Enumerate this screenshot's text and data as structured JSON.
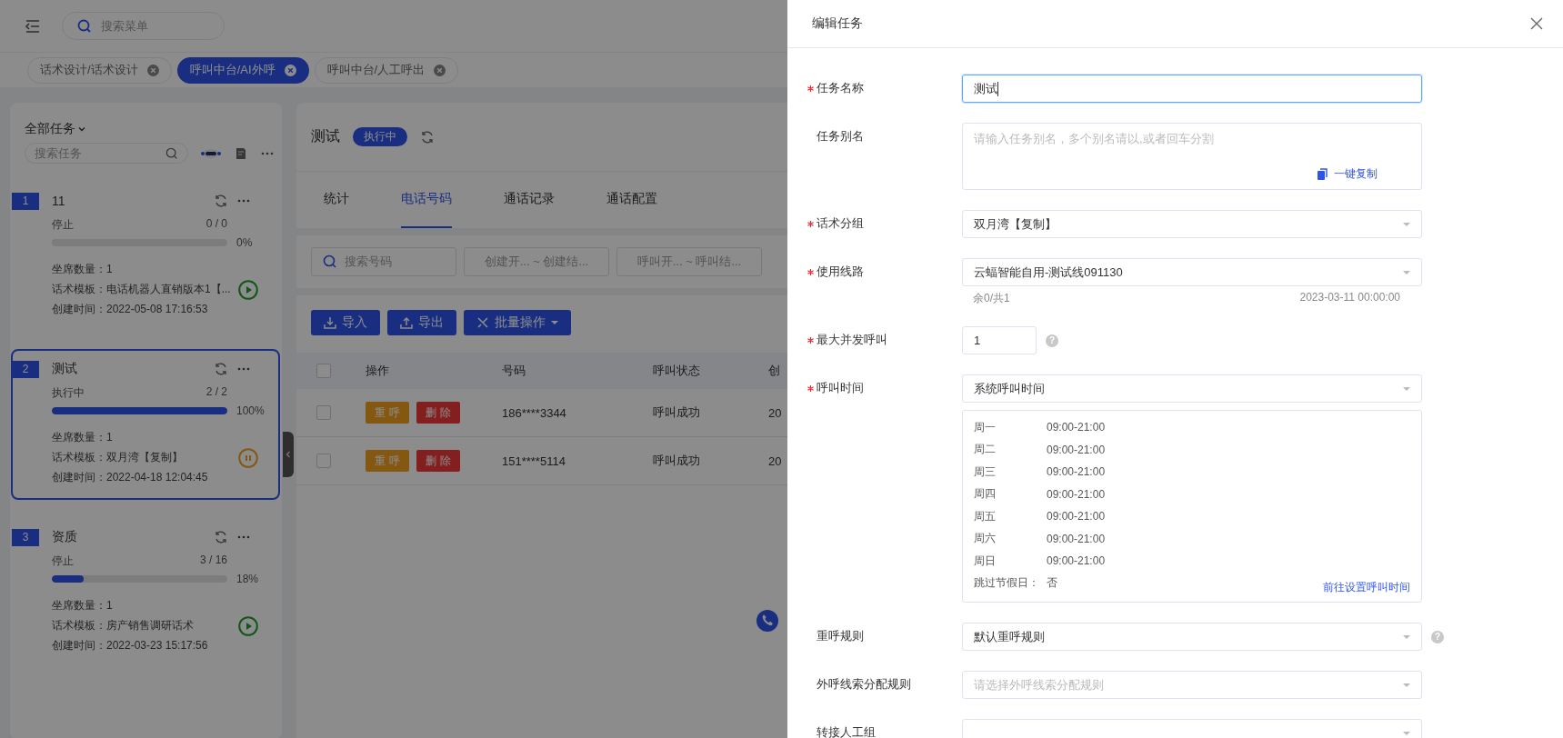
{
  "header": {
    "search_placeholder": "搜索菜单"
  },
  "tabs": [
    {
      "label": "话术设计/话术设计",
      "selected": false
    },
    {
      "label": "呼叫中台/AI外呼",
      "selected": true
    },
    {
      "label": "呼叫中台/人工呼出",
      "selected": false
    }
  ],
  "task_panel": {
    "title": "全部任务",
    "search_placeholder": "搜索任务",
    "tasks": [
      {
        "index": "1",
        "name": "11",
        "status": "停止",
        "count": "0 / 0",
        "level": 0,
        "percent": "0%",
        "seats": "坐席数量：1",
        "template": "话术模板：电话机器人直销版本1【...",
        "created": "创建时间：2022-05-08 17:16:53",
        "kind": "play",
        "selected": false
      },
      {
        "index": "2",
        "name": "测试",
        "status": "执行中",
        "count": "2 / 2",
        "level": 1,
        "percent": "100%",
        "seats": "坐席数量：1",
        "template": "话术模板：双月湾【复制】",
        "created": "创建时间：2022-04-18 12:04:45",
        "kind": "pause",
        "selected": true
      },
      {
        "index": "3",
        "name": "资质",
        "status": "停止",
        "count": "3 / 16",
        "level": 0.18,
        "percent": "18%",
        "seats": "坐席数量：1",
        "template": "话术模板：房产销售调研话术",
        "created": "创建时间：2022-03-23 15:17:56",
        "kind": "play",
        "selected": false
      }
    ]
  },
  "detail": {
    "title": "测试",
    "status": "执行中",
    "tabs": [
      {
        "label": "统计",
        "selected": false
      },
      {
        "label": "电话号码",
        "selected": true
      },
      {
        "label": "通话记录",
        "selected": false
      },
      {
        "label": "通话配置",
        "selected": false
      }
    ],
    "filters": [
      {
        "kind": "search",
        "placeholder": "搜索号码"
      },
      {
        "kind": "range",
        "placeholder": "创建开... ~ 创建结..."
      },
      {
        "kind": "range",
        "placeholder": "呼叫开... ~ 呼叫结..."
      }
    ],
    "buttons": [
      {
        "kind": "import",
        "label": "导入",
        "dropdown": false
      },
      {
        "kind": "export",
        "label": "导出",
        "dropdown": false
      },
      {
        "kind": "batch",
        "label": "批量操作",
        "dropdown": true
      }
    ],
    "columns": [
      "操作",
      "号码",
      "呼叫状态",
      "创"
    ],
    "header_checked": false,
    "rows": [
      {
        "checked": false,
        "actions": [
          {
            "kind": "redial",
            "label": "重 呼"
          },
          {
            "kind": "delete",
            "label": "删 除"
          }
        ],
        "number": "186****3344",
        "status": "呼叫成功",
        "column_4": "20"
      },
      {
        "checked": false,
        "actions": [
          {
            "kind": "redial",
            "label": "重 呼"
          },
          {
            "kind": "delete",
            "label": "删 除"
          }
        ],
        "number": "151****5114",
        "status": "呼叫成功",
        "column_4": "20"
      }
    ]
  },
  "drawer": {
    "title": "编辑任务",
    "fields": [
      {
        "kind": "input",
        "label": "任务名称",
        "required": true,
        "value": "测试",
        "focused": true
      },
      {
        "kind": "textarea",
        "label": "任务别名",
        "required": false,
        "placeholder": "请输入任务别名，多个别名请以,或者回车分割",
        "action": "一键复制"
      },
      {
        "kind": "select",
        "label": "话术分组",
        "required": true,
        "value": "双月湾【复制】"
      },
      {
        "kind": "select",
        "label": "使用线路",
        "required": true,
        "value": "云蝠智能自用-测试线091130",
        "hint_left": "余0/共1",
        "hint_right": "2023-03-11 00:00:00"
      },
      {
        "kind": "number",
        "label": "最大并发呼叫",
        "required": true,
        "value": "1",
        "help": "?"
      },
      {
        "kind": "schedule",
        "label": "呼叫时间",
        "required": true,
        "value": "系统呼叫时间",
        "days": [
          {
            "day": "周一",
            "hours": "09:00-21:00"
          },
          {
            "day": "周二",
            "hours": "09:00-21:00"
          },
          {
            "day": "周三",
            "hours": "09:00-21:00"
          },
          {
            "day": "周四",
            "hours": "09:00-21:00"
          },
          {
            "day": "周五",
            "hours": "09:00-21:00"
          },
          {
            "day": "周六",
            "hours": "09:00-21:00"
          },
          {
            "day": "周日",
            "hours": "09:00-21:00"
          }
        ],
        "skip_label": "跳过节假日：",
        "skip_value": "否",
        "link": "前往设置呼叫时间"
      },
      {
        "kind": "select",
        "label": "重呼规则",
        "required": false,
        "value": "默认重呼规则",
        "help": "?"
      },
      {
        "kind": "select",
        "label": "外呼线索分配规则",
        "required": false,
        "placeholder": "请选择外呼线索分配规则"
      },
      {
        "kind": "select",
        "label": "转接人工组",
        "required": false
      }
    ]
  }
}
